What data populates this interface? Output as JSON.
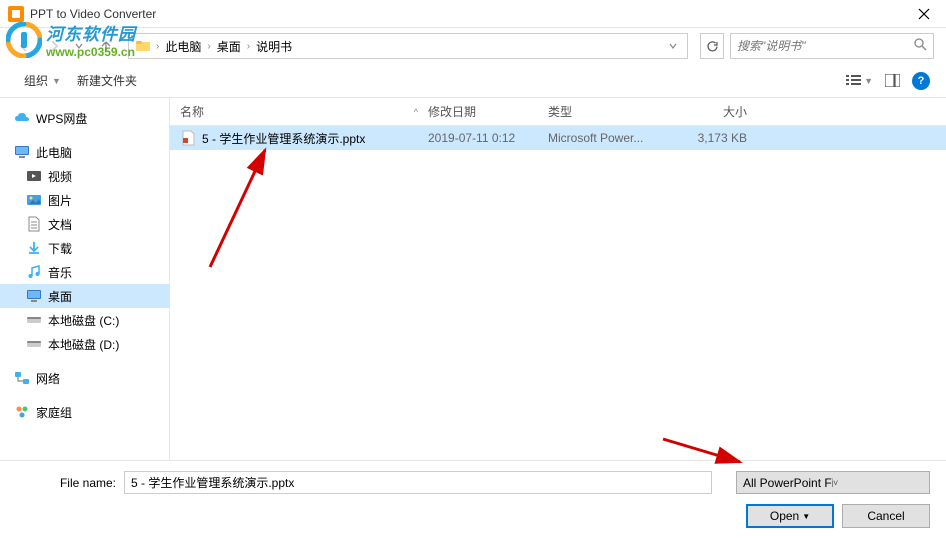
{
  "title": "PPT to Video Converter",
  "breadcrumb": {
    "pc": "此电脑",
    "desktop": "桌面",
    "folder": "说明书"
  },
  "search": {
    "placeholder": "搜索\"说明书\""
  },
  "toolbar": {
    "organize": "组织",
    "newfolder": "新建文件夹"
  },
  "columns": {
    "name": "名称",
    "date": "修改日期",
    "type": "类型",
    "size": "大小"
  },
  "sidebar": {
    "wps": "WPS网盘",
    "thispc": "此电脑",
    "videos": "视频",
    "pictures": "图片",
    "documents": "文档",
    "downloads": "下载",
    "music": "音乐",
    "desktop": "桌面",
    "diskc": "本地磁盘 (C:)",
    "diskd": "本地磁盘 (D:)",
    "network": "网络",
    "homegroup": "家庭组"
  },
  "file": {
    "name": "5 - 学生作业管理系统演示.pptx",
    "date": "2019-07-11 0:12",
    "type": "Microsoft Power...",
    "size": "3,173 KB"
  },
  "filename": {
    "label": "File name:",
    "value": "5 - 学生作业管理系统演示.pptx"
  },
  "filetype": "All PowerPoint Files (*.ppt;*.ppt",
  "buttons": {
    "open": "Open",
    "cancel": "Cancel"
  },
  "watermark": {
    "cn": "河东软件园",
    "url": "www.pc0359.cn"
  }
}
